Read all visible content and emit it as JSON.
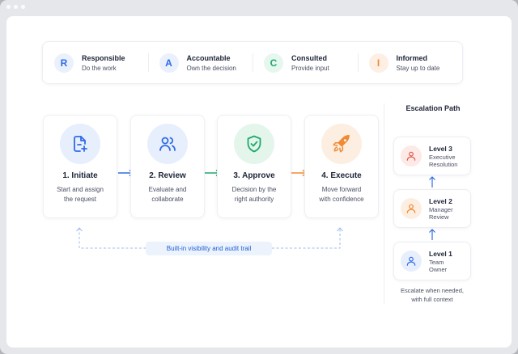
{
  "raci": [
    {
      "letter": "R",
      "title": "Responsible",
      "sub": "Do the work",
      "color": "#2f6be6",
      "bg": "#eaf1fd"
    },
    {
      "letter": "A",
      "title": "Accountable",
      "sub": "Own the decision",
      "color": "#2f6be6",
      "bg": "#eaf1fd"
    },
    {
      "letter": "C",
      "title": "Consulted",
      "sub": "Provide input",
      "color": "#1ea96a",
      "bg": "#e6f7ef"
    },
    {
      "letter": "I",
      "title": "Informed",
      "sub": "Stay up to date",
      "color": "#f08a33",
      "bg": "#fdefe3"
    }
  ],
  "steps": [
    {
      "title": "1. Initiate",
      "desc_line1": "Start and assign",
      "desc_line2": "the request",
      "icon": "add-document-icon",
      "color": "#2f6be6",
      "bg": "#e7effd"
    },
    {
      "title": "2. Review",
      "desc_line1": "Evaluate and",
      "desc_line2": "collaborate",
      "icon": "users-icon",
      "color": "#2f6be6",
      "bg": "#e7effd"
    },
    {
      "title": "3. Approve",
      "desc_line1": "Decision by the",
      "desc_line2": "right authority",
      "icon": "shield-check-icon",
      "color": "#1ea96a",
      "bg": "#e4f6ec"
    },
    {
      "title": "4. Execute",
      "desc_line1": "Move forward",
      "desc_line2": "with confidence",
      "icon": "rocket-icon",
      "color": "#f08a33",
      "bg": "#fdeee2"
    }
  ],
  "trail_label": "Built-in visibility and audit trail",
  "escalation": {
    "title": "Escalation Path",
    "levels": [
      {
        "title": "Level 3",
        "desc_line1": "Executive",
        "desc_line2": "Resolution",
        "icon": "user-icon",
        "color": "#e0584a",
        "bg": "#fde9e6"
      },
      {
        "title": "Level 2",
        "desc_line1": "Manager",
        "desc_line2": "Review",
        "icon": "user-icon",
        "color": "#f08a33",
        "bg": "#fdeee2"
      },
      {
        "title": "Level 1",
        "desc_line1": "Team",
        "desc_line2": "Owner",
        "icon": "user-icon",
        "color": "#2f6be6",
        "bg": "#e7effd"
      }
    ],
    "note_line1": "Escalate when needed,",
    "note_line2": "with full context"
  }
}
